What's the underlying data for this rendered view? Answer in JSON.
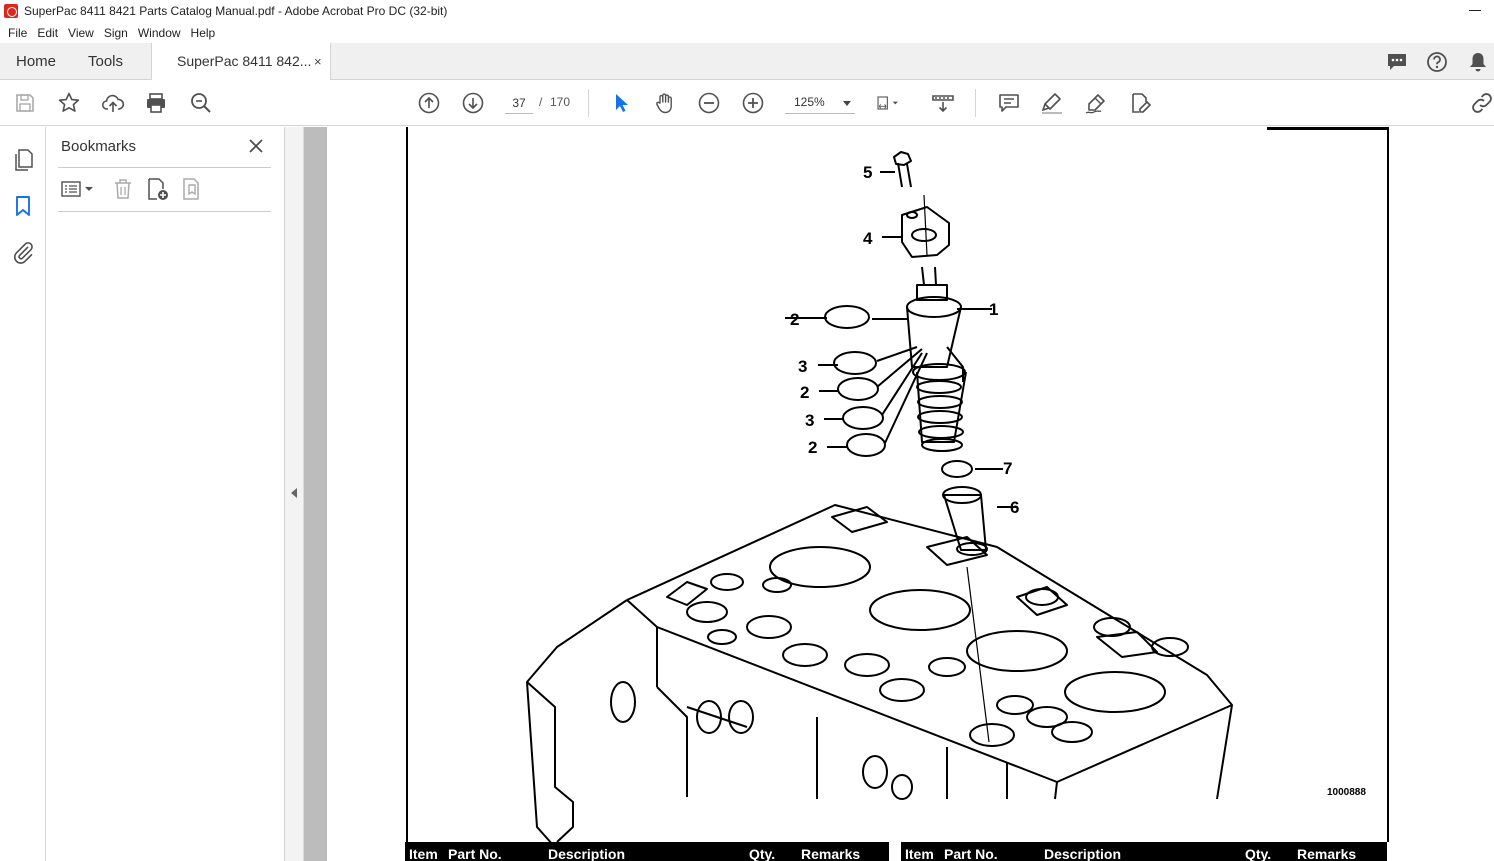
{
  "window": {
    "title": "SuperPac 8411 8421 Parts Catalog Manual.pdf - Adobe Acrobat Pro DC (32-bit)"
  },
  "menu": [
    "File",
    "Edit",
    "View",
    "Sign",
    "Window",
    "Help"
  ],
  "tabs": {
    "home": "Home",
    "tools": "Tools",
    "document": "SuperPac 8411 842...",
    "close_glyph": "×"
  },
  "toolbar": {
    "page_current": "37",
    "page_separator": "/",
    "page_total": "170",
    "zoom": "125%"
  },
  "bookmarks": {
    "title": "Bookmarks"
  },
  "document": {
    "figure_number": "1000888",
    "callouts": [
      "5",
      "4",
      "1",
      "2",
      "3",
      "2",
      "3",
      "2",
      "7",
      "6"
    ],
    "table_headers_left": [
      "Item",
      "Part No.",
      "Description",
      "Qty.",
      "Remarks"
    ],
    "table_headers_right": [
      "Item",
      "Part No.",
      "Description",
      "Qty.",
      "Remarks"
    ]
  },
  "colors": {
    "acrobat_red": "#d9291c",
    "cursor_blue": "#1473e6",
    "icon_gray": "#505050"
  }
}
